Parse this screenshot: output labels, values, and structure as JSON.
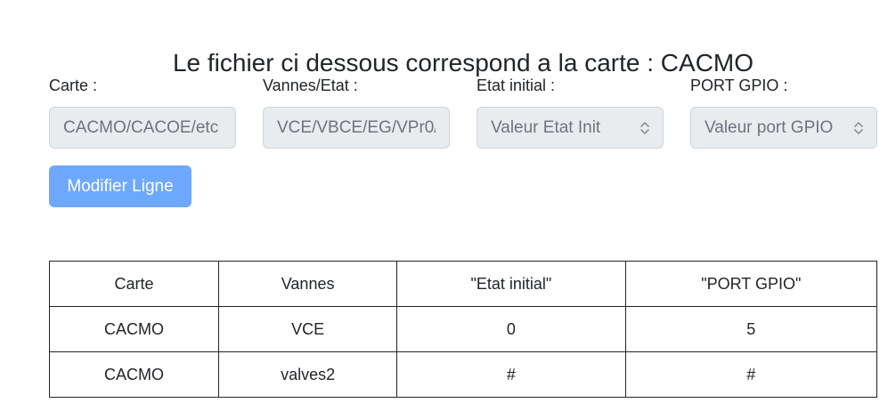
{
  "page": {
    "title": "Le fichier ci dessous correspond a la carte : CACMO"
  },
  "form": {
    "carte": {
      "label": "Carte :",
      "placeholder": "CACMO/CACOE/etc"
    },
    "vannes": {
      "label": "Vannes/Etat :",
      "placeholder": "VCE/VBCE/EG/VPr0/"
    },
    "etat_initial": {
      "label": "Etat initial :",
      "selected": "Valeur Etat Init"
    },
    "port_gpio": {
      "label": "PORT GPIO :",
      "selected": "Valeur port GPIO"
    },
    "modify_button": "Modifier Ligne"
  },
  "table": {
    "headers": [
      "Carte",
      "Vannes",
      "\"Etat initial\"",
      "\"PORT GPIO\""
    ],
    "rows": [
      [
        "CACMO",
        "VCE",
        "0",
        "5"
      ],
      [
        "CACMO",
        "valves2",
        "#",
        "#"
      ]
    ]
  },
  "colors": {
    "button_bg": "#6ea8fe",
    "disabled_field_bg": "#e9ecef",
    "text": "#212529",
    "placeholder_text": "#6c757d"
  }
}
